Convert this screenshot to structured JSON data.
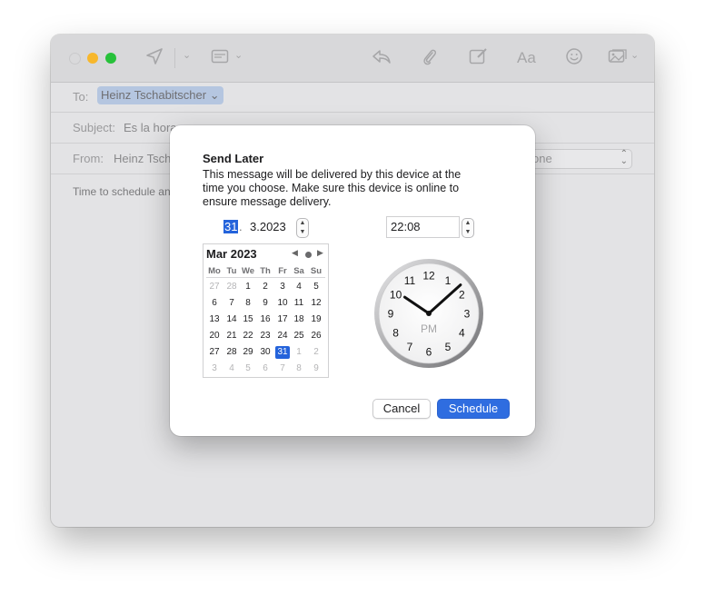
{
  "colors": {
    "accent": "#2463db",
    "close": "#d9d9db",
    "minimize": "#f7b72c",
    "zoom": "#27c13a"
  },
  "toolbar": {
    "icons": [
      "send-icon",
      "chevron-down-icon",
      "header-fields-icon",
      "chevron-down-icon",
      "reply-icon",
      "paperclip-icon",
      "markup-icon",
      "format-text-icon",
      "emoji-icon",
      "photo-browser-icon"
    ],
    "format_label": "Aa"
  },
  "compose": {
    "to_label": "To:",
    "to_value": "Heinz Tschabitscher",
    "subject_label": "Subject:",
    "subject_value": "Es la hora",
    "from_label": "From:",
    "from_value": "Heinz Tsch",
    "from_select_value": "one",
    "body_text": "Time to schedule an"
  },
  "dialog": {
    "title": "Send Later",
    "message": "This message will be delivered by this device at the time you choose. Make sure this device is online to ensure message delivery.",
    "date_day": "31",
    "date_sep": ".",
    "date_rest": "3.2023",
    "time_value": "22:08",
    "calendar": {
      "month_label": "Mar 2023",
      "nav_prev": "◀",
      "nav_next": "▶",
      "weekdays": [
        "Mo",
        "Tu",
        "We",
        "Th",
        "Fr",
        "Sa",
        "Su"
      ],
      "weeks": [
        [
          "27",
          "28",
          "1",
          "2",
          "3",
          "4",
          "5"
        ],
        [
          "6",
          "7",
          "8",
          "9",
          "10",
          "11",
          "12"
        ],
        [
          "13",
          "14",
          "15",
          "16",
          "17",
          "18",
          "19"
        ],
        [
          "20",
          "21",
          "22",
          "23",
          "24",
          "25",
          "26"
        ],
        [
          "27",
          "28",
          "29",
          "30",
          "31",
          "1",
          "2"
        ],
        [
          "3",
          "4",
          "5",
          "6",
          "7",
          "8",
          "9"
        ]
      ],
      "muted": [
        [
          0,
          0
        ],
        [
          0,
          1
        ],
        [
          4,
          5
        ],
        [
          4,
          6
        ],
        [
          5,
          0
        ],
        [
          5,
          1
        ],
        [
          5,
          2
        ],
        [
          5,
          3
        ],
        [
          5,
          4
        ],
        [
          5,
          5
        ],
        [
          5,
          6
        ]
      ],
      "selected": [
        4,
        4
      ]
    },
    "clock": {
      "numbers": [
        "12",
        "1",
        "2",
        "3",
        "4",
        "5",
        "6",
        "7",
        "8",
        "9",
        "10",
        "11"
      ],
      "period": "PM",
      "hour": 22,
      "minute": 8
    },
    "cancel_label": "Cancel",
    "schedule_label": "Schedule"
  }
}
